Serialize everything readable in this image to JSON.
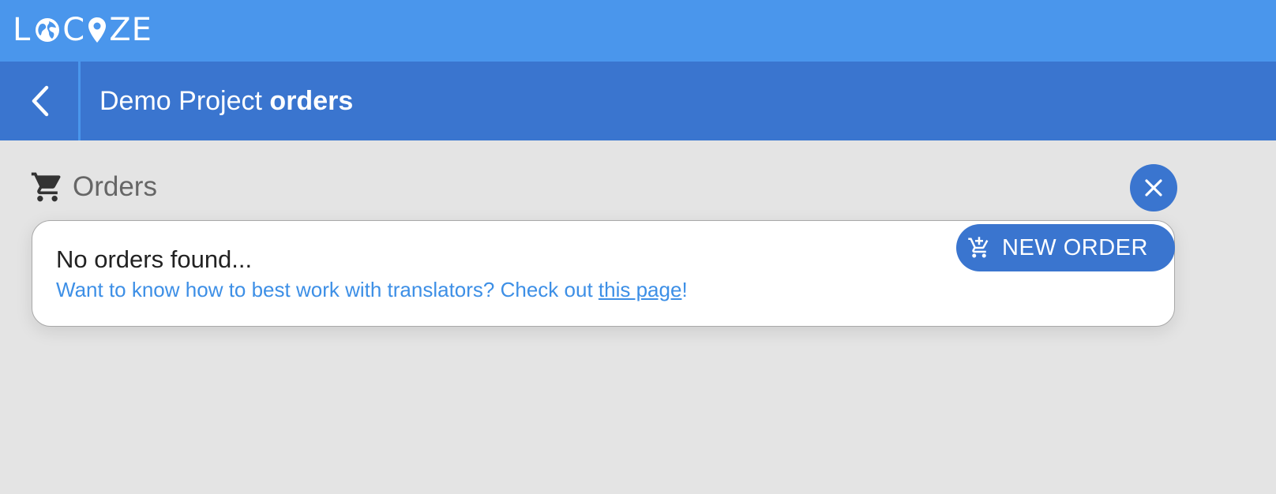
{
  "app": {
    "logo_text_1": "L",
    "logo_text_2": "C",
    "logo_text_3": "ZE"
  },
  "header": {
    "project_name": "Demo Project",
    "page_name": "orders",
    "back_icon": "chevron-left-icon"
  },
  "section": {
    "title": "Orders",
    "icon": "cart-icon",
    "close_icon": "close-icon"
  },
  "empty_state": {
    "message": "No orders found...",
    "hint_prefix": "Want to know how to best work with translators? Check out ",
    "hint_link": "this page",
    "hint_suffix": "!"
  },
  "actions": {
    "new_order_label": "NEW ORDER",
    "new_order_icon": "add-cart-icon"
  },
  "colors": {
    "topbar": "#4a96ec",
    "subbar": "#3a75cf",
    "accent": "#3a75cf",
    "link": "#3d8fe6",
    "background": "#e4e4e4"
  }
}
